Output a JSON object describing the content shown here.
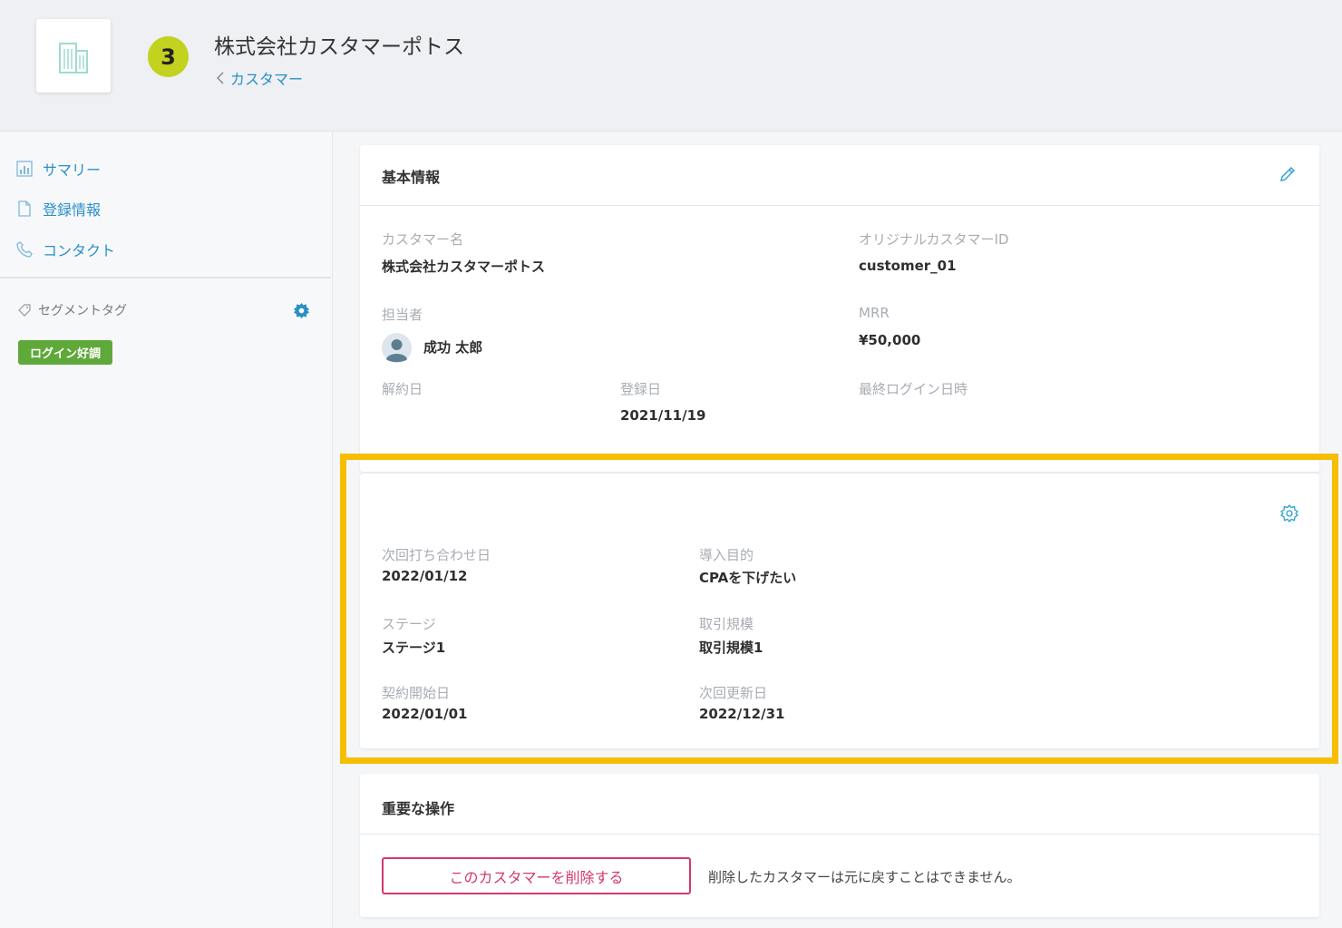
{
  "header": {
    "step_number": "3",
    "company_name": "株式会社カスタマーポトス",
    "breadcrumb_label": "カスタマー"
  },
  "sidebar": {
    "nav": [
      {
        "label": "サマリー",
        "icon": "chart-icon"
      },
      {
        "label": "登録情報",
        "icon": "document-icon"
      },
      {
        "label": "コンタクト",
        "icon": "phone-icon"
      }
    ],
    "segment_tag_heading": "セグメントタグ",
    "tags": [
      "ログイン好調"
    ]
  },
  "basic_info": {
    "title": "基本情報",
    "customer_name_label": "カスタマー名",
    "customer_name_value": "株式会社カスタマーポトス",
    "original_id_label": "オリジナルカスタマーID",
    "original_id_value": "customer_01",
    "owner_label": "担当者",
    "owner_value": "成功 太郎",
    "mrr_label": "MRR",
    "mrr_value": "¥50,000",
    "cancel_date_label": "解約日",
    "registered_label": "登録日",
    "registered_value": "2021/11/19",
    "last_login_label": "最終ログイン日時"
  },
  "custom_fields": {
    "next_meeting_label": "次回打ち合わせ日",
    "next_meeting_value": "2022/01/12",
    "purpose_label": "導入目的",
    "purpose_value": "CPAを下げたい",
    "stage_label": "ステージ",
    "stage_value": "ステージ1",
    "deal_size_label": "取引規模",
    "deal_size_value": "取引規模1",
    "contract_start_label": "契約開始日",
    "contract_start_value": "2022/01/01",
    "next_renewal_label": "次回更新日",
    "next_renewal_value": "2022/12/31"
  },
  "danger": {
    "title": "重要な操作",
    "delete_button": "このカスタマーを削除する",
    "delete_note": "削除したカスタマーは元に戻すことはできません。"
  },
  "colors": {
    "accent": "#2a8fc8",
    "step_badge": "#c2d21f",
    "tag": "#5fa83a",
    "danger": "#d4386e",
    "highlight": "#f6be00"
  }
}
